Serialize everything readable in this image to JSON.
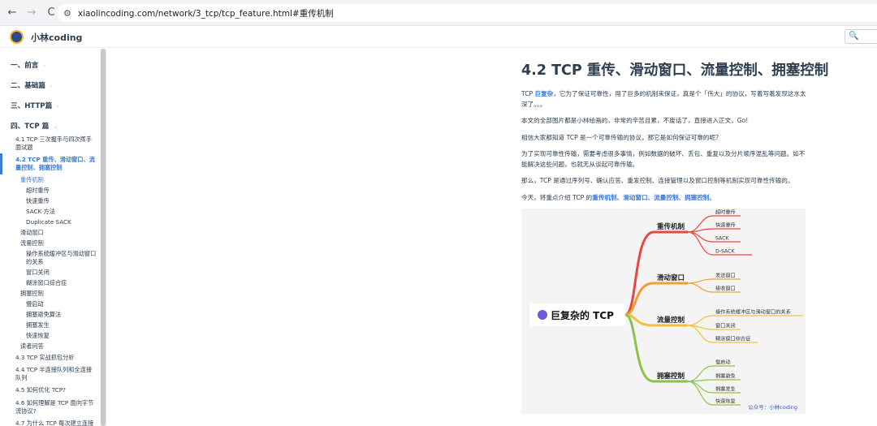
{
  "browser": {
    "back_icon": "←",
    "forward_icon": "→",
    "reload_icon": "C",
    "url": "xiaolincoding.com/network/3_tcp/tcp_feature.html#重传机制"
  },
  "header": {
    "site_name": "小林coding",
    "search_placeholder": ""
  },
  "sidebar": {
    "sections": [
      {
        "label": "一、前言"
      },
      {
        "label": "二、基础篇"
      },
      {
        "label": "三、HTTP篇"
      },
      {
        "label": "四、TCP 篇"
      }
    ],
    "items": [
      {
        "label": "4.1 TCP 三次握手与四次挥手"
      },
      {
        "label": "面试题"
      },
      {
        "label": "4.2 TCP 重传、滑动窗口、流"
      },
      {
        "label": "量控制、拥塞控制"
      },
      {
        "label": "重传机制"
      },
      {
        "label": "超时重传"
      },
      {
        "label": "快速重传"
      },
      {
        "label": "SACK 方法"
      },
      {
        "label": "Duplicate SACK"
      },
      {
        "label": "滑动窗口"
      },
      {
        "label": "流量控制"
      },
      {
        "label": "操作系统缓冲区与滑动窗口"
      },
      {
        "label": "的关系"
      },
      {
        "label": "窗口关闭"
      },
      {
        "label": "糊涂窗口综合症"
      },
      {
        "label": "拥塞控制"
      },
      {
        "label": "慢启动"
      },
      {
        "label": "拥塞避免算法"
      },
      {
        "label": "拥塞发生"
      },
      {
        "label": "快速恢复"
      },
      {
        "label": "读者问答"
      },
      {
        "label": "4.3 TCP 实战抓包分析"
      },
      {
        "label": "4.4 TCP 半连接队列和全连接"
      },
      {
        "label": "队列"
      },
      {
        "label": "4.5 如何优化 TCP?"
      },
      {
        "label": "4.6 如何理解是 TCP 面向字节"
      },
      {
        "label": "流协议?"
      },
      {
        "label": "4.7 为什么 TCP 每次建立连接"
      }
    ]
  },
  "article": {
    "title": "4.2 TCP 重传、滑动窗口、流量控制、拥塞控制",
    "p1_a": "TCP ",
    "p1_link": "巨复杂",
    "p1_b": "，它为了保证可靠性，用了巨多的机制来保证，真是个「伟大」的协议，写着写着发现这水太深了。。。",
    "p2": "本文的全部图片都是小林绘画的，非常的辛苦且累，不废话了，直接进入正文，Go!",
    "p3": "相信大家都知道 TCP 是一个可靠传输的协议，那它是如何保证可靠的呢?",
    "p4": "为了实现可靠性传输，需要考虑很多事情，例如数据的破坏、丢包、重复以及分片顺序混乱等问题。如不能解决这些问题，也就无从谈起可靠传输。",
    "p5": "那么，TCP 是通过序列号、确认应答、重发控制、连接管理以及窗口控制等机制实现可靠性传输的。",
    "p6_a": "今天，将重点介绍 TCP 的",
    "p6_link": "重传机制、滑动窗口、流量控制、拥塞控制",
    "p6_b": "。"
  },
  "mindmap": {
    "root": "巨复杂的 TCP",
    "watermark": "公众号：小林coding",
    "branches": [
      {
        "name": "重传机制",
        "color": "#e8473f",
        "leaves": [
          "超时重传",
          "快速重传",
          "SACK",
          "D-SACK"
        ]
      },
      {
        "name": "滑动窗口",
        "color": "#f0a030",
        "leaves": [
          "发送窗口",
          "接收窗口"
        ]
      },
      {
        "name": "流量控制",
        "color": "#f2c33a",
        "leaves": [
          "操作系统缓冲区与滑动窗口的关系",
          "窗口关闭",
          "糊涂窗口综合症"
        ]
      },
      {
        "name": "拥塞控制",
        "color": "#8dc24a",
        "leaves": [
          "慢启动",
          "拥塞避免",
          "拥塞发生",
          "快速恢复"
        ]
      }
    ]
  }
}
